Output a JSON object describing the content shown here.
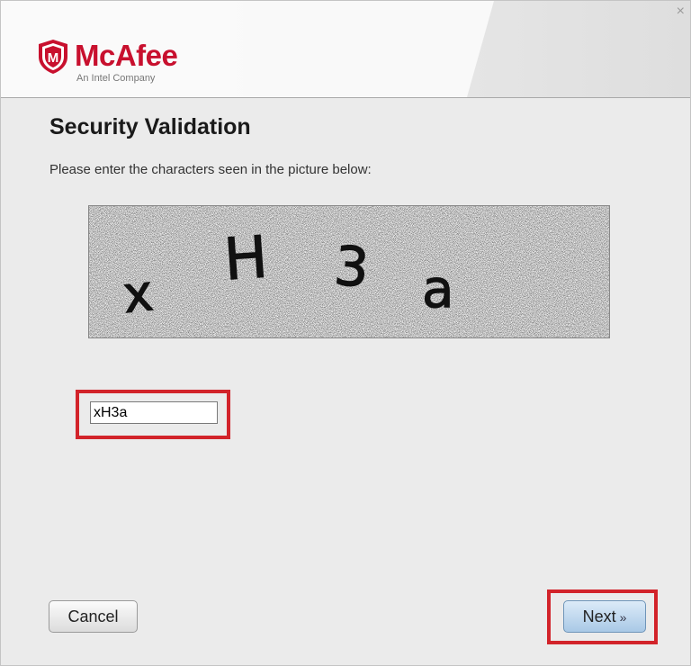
{
  "window": {
    "close_glyph": "×"
  },
  "brand": {
    "name": "McAfee",
    "tagline": "An Intel Company",
    "shield_letter": "M",
    "color": "#c8102e"
  },
  "page": {
    "title": "Security Validation",
    "instruction": "Please enter the characters seen in the picture below:"
  },
  "captcha": {
    "characters": [
      "x",
      "H",
      "3",
      "a"
    ]
  },
  "form": {
    "captcha_value": "xH3a"
  },
  "buttons": {
    "cancel_label": "Cancel",
    "next_label": "Next",
    "next_glyph": "»"
  },
  "colors": {
    "highlight": "#d2232a",
    "next_button": "#a9c9e6"
  }
}
